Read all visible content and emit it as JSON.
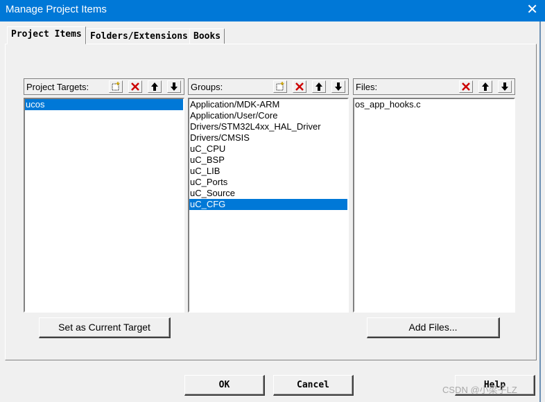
{
  "window": {
    "title": "Manage Project Items",
    "close_glyph": "✕"
  },
  "tabs": [
    "Project Items",
    "Folders/Extensions",
    "Books"
  ],
  "targets": {
    "label": "Project Targets:",
    "items": [
      "ucos"
    ],
    "selected_index": 0
  },
  "groups": {
    "label": "Groups:",
    "items": [
      "Application/MDK-ARM",
      "Application/User/Core",
      "Drivers/STM32L4xx_HAL_Driver",
      "Drivers/CMSIS",
      "uC_CPU",
      "uC_BSP",
      "uC_LIB",
      "uC_Ports",
      "uC_Source",
      "uC_CFG"
    ],
    "selected_index": 9
  },
  "files": {
    "label": "Files:",
    "items": [
      "os_app_hooks.c"
    ]
  },
  "buttons": {
    "set_target": "Set as Current Target",
    "add_files": "Add Files...",
    "ok": "OK",
    "cancel": "Cancel",
    "help": "Help"
  },
  "icons": {
    "new": "new-item-icon",
    "delete": "delete-x-icon",
    "up": "arrow-up-icon",
    "down": "arrow-down-icon"
  },
  "colors": {
    "titlebar": "#0078d7",
    "selection": "#0078d7",
    "delete": "#cc0000"
  },
  "watermark": "CSDN @小梁子LZ"
}
